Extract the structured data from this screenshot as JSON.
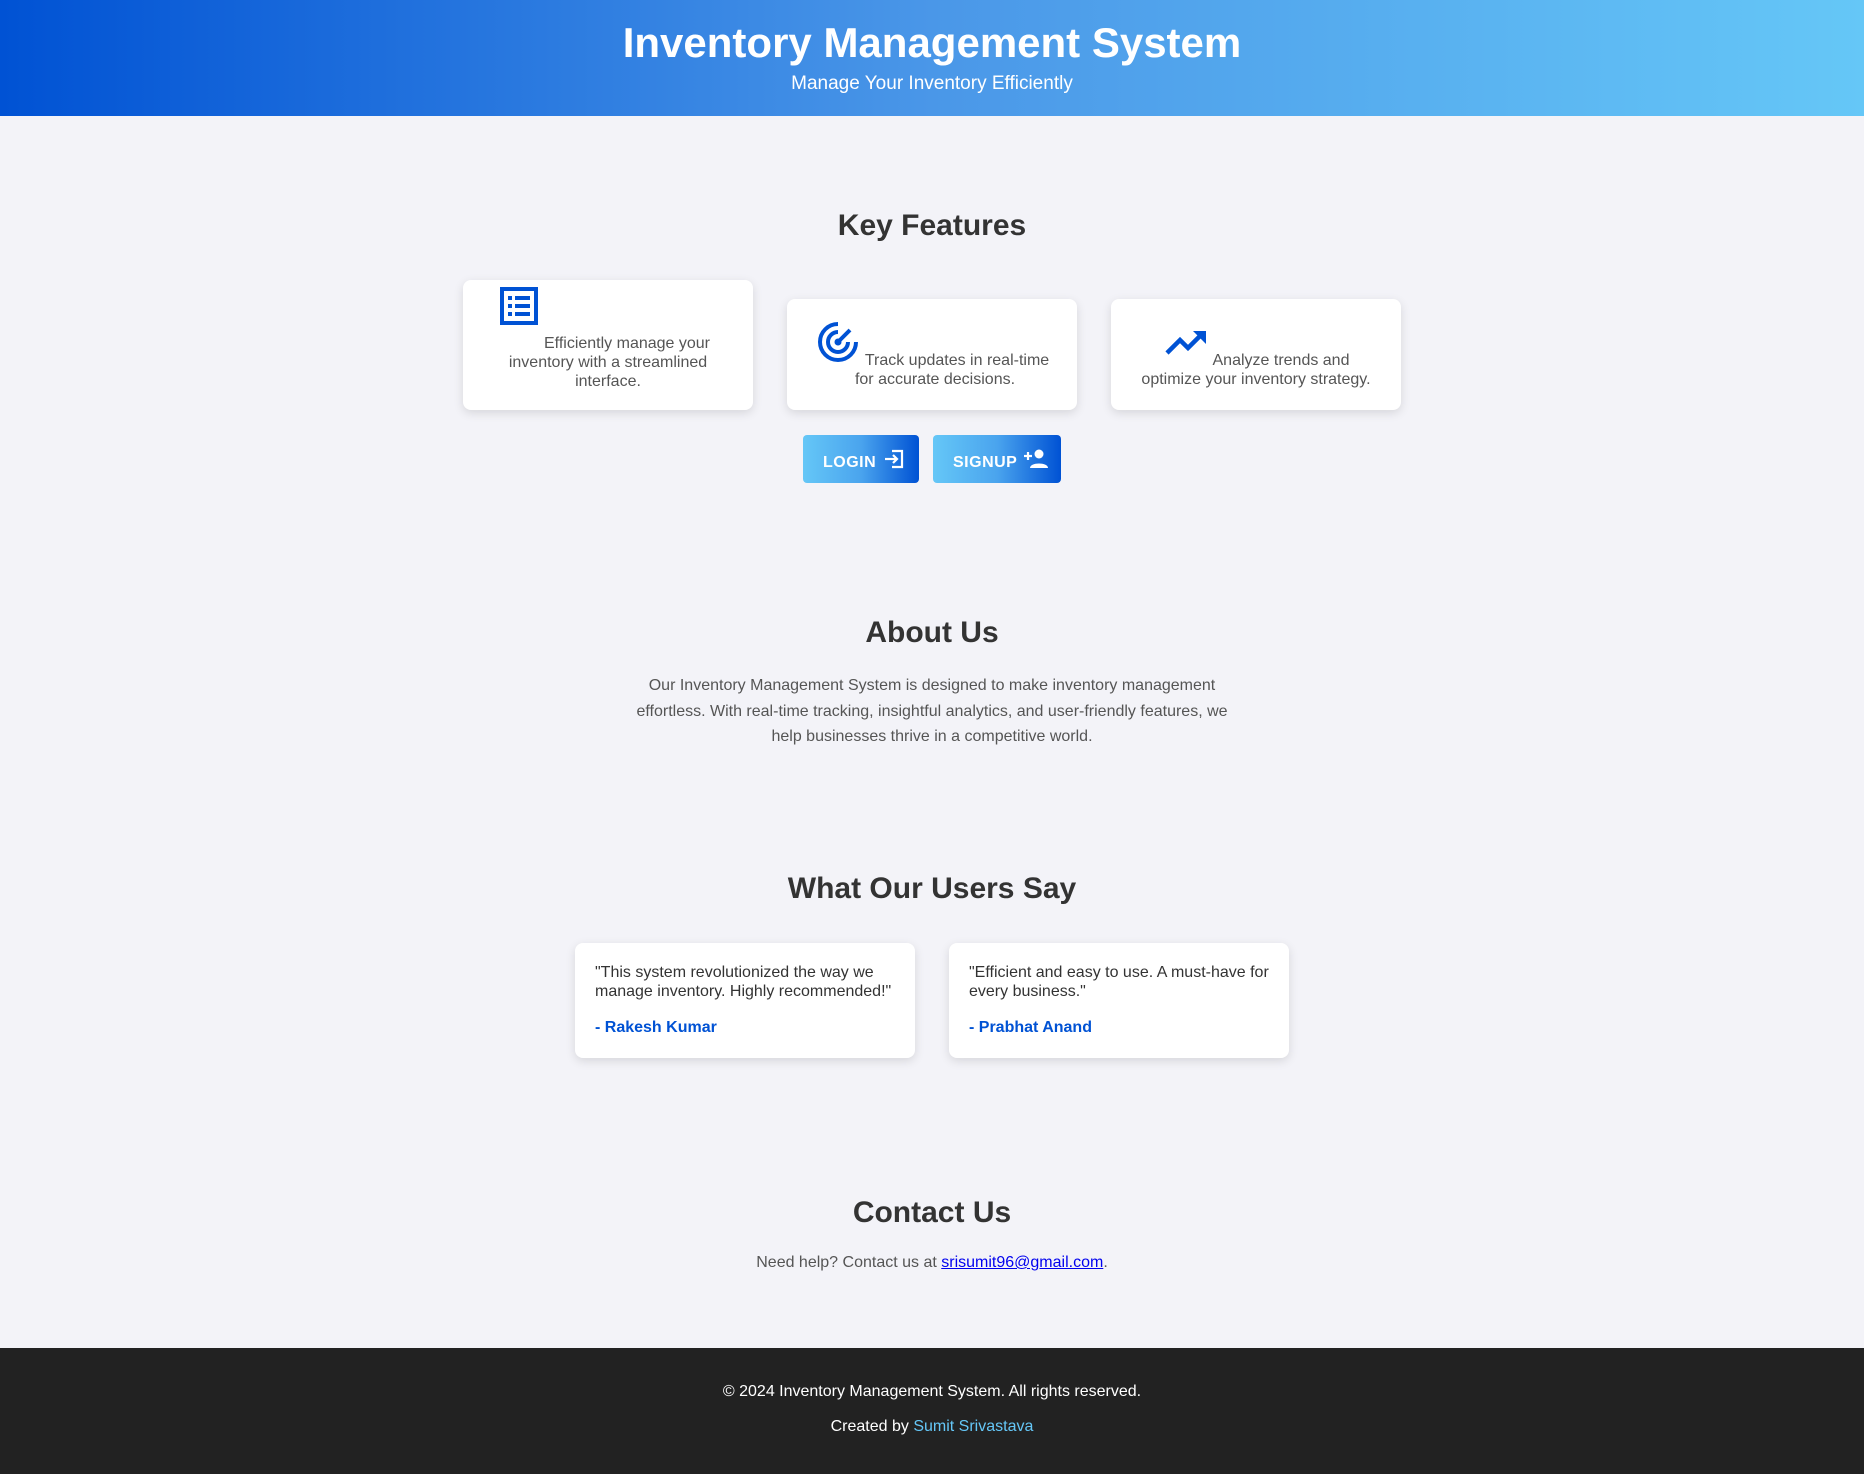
{
  "header": {
    "title": "Inventory Management System",
    "tagline": "Manage Your Inventory Efficiently"
  },
  "features": {
    "title": "Key Features",
    "items": [
      {
        "icon": "list-icon",
        "text": "Efficiently manage your inventory with a streamlined interface."
      },
      {
        "icon": "radar-icon",
        "text": "Track updates in real-time for accurate decisions."
      },
      {
        "icon": "trending-up-icon",
        "text": "Analyze trends and optimize your inventory strategy."
      }
    ]
  },
  "actions": {
    "login_label": "LOGIN",
    "signup_label": "SIGNUP"
  },
  "about": {
    "title": "About Us",
    "text": "Our Inventory Management System is designed to make inventory management effortless. With real-time tracking, insightful analytics, and user-friendly features, we help businesses thrive in a competitive world."
  },
  "testimonials": {
    "title": "What Our Users Say",
    "items": [
      {
        "quote": "\"This system revolutionized the way we manage inventory. Highly recommended!\"",
        "author": "- Rakesh Kumar"
      },
      {
        "quote": "\"Efficient and easy to use. A must-have for every business.\"",
        "author": "- Prabhat Anand"
      }
    ]
  },
  "contact": {
    "title": "Contact Us",
    "prefix": "Need help? Contact us at ",
    "email": "srisumit96@gmail.com",
    "suffix": "."
  },
  "footer": {
    "copyright": "© 2024 Inventory Management System. All rights reserved.",
    "credit_prefix": "Created by ",
    "credit_name": "Sumit Srivastava"
  },
  "colors": {
    "brand_dark": "#0052d4",
    "brand_light": "#65c7f7",
    "footer_bg": "#222222",
    "page_bg": "#f3f3f8"
  }
}
